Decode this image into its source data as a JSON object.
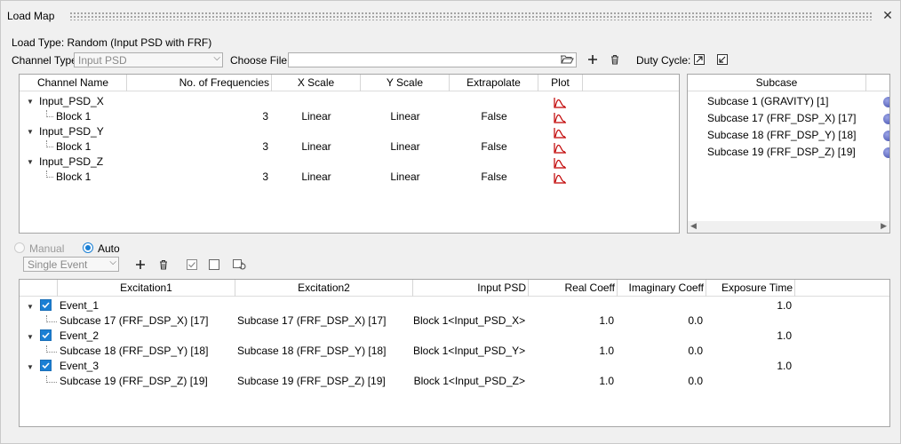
{
  "window": {
    "title": "Load Map",
    "close_glyph": "✕"
  },
  "load_type": "Load Type: Random (Input PSD with FRF)",
  "channel_type": {
    "label": "Channel Type:",
    "value": "Input PSD"
  },
  "choose_file": {
    "label": "Choose File:",
    "value": ""
  },
  "duty_cycle": {
    "label": "Duty Cycle:"
  },
  "channel_table": {
    "headers": [
      "Channel Name",
      "No. of Frequencies",
      "X Scale",
      "Y Scale",
      "Extrapolate",
      "Plot"
    ],
    "rows": [
      {
        "name": "Input_PSD_X",
        "block": "Block 1",
        "freqs": "3",
        "xscale": "Linear",
        "yscale": "Linear",
        "extrap": "False"
      },
      {
        "name": "Input_PSD_Y",
        "block": "Block 1",
        "freqs": "3",
        "xscale": "Linear",
        "yscale": "Linear",
        "extrap": "False"
      },
      {
        "name": "Input_PSD_Z",
        "block": "Block 1",
        "freqs": "3",
        "xscale": "Linear",
        "yscale": "Linear",
        "extrap": "False"
      }
    ]
  },
  "subcase_panel": {
    "header": "Subcase",
    "items": [
      "Subcase 1 (GRAVITY) [1]",
      "Subcase 17 (FRF_DSP_X) [17]",
      "Subcase 18 (FRF_DSP_Y) [18]",
      "Subcase 19 (FRF_DSP_Z) [19]"
    ]
  },
  "mode": {
    "manual": "Manual",
    "auto": "Auto",
    "selected": "Auto"
  },
  "event_type": {
    "value": "Single Event"
  },
  "event_table": {
    "headers": [
      "Excitation1",
      "Excitation2",
      "Input PSD",
      "Real Coeff",
      "Imaginary Coeff",
      "Exposure Time"
    ],
    "rows": [
      {
        "event": "Event_1",
        "exposure": "1.0",
        "exc1": "Subcase 17 (FRF_DSP_X) [17]",
        "exc2": "Subcase 17 (FRF_DSP_X) [17]",
        "psd": "Block 1<Input_PSD_X>",
        "real": "1.0",
        "imag": "0.0"
      },
      {
        "event": "Event_2",
        "exposure": "1.0",
        "exc1": "Subcase 18 (FRF_DSP_Y) [18]",
        "exc2": "Subcase 18 (FRF_DSP_Y) [18]",
        "psd": "Block 1<Input_PSD_Y>",
        "real": "1.0",
        "imag": "0.0"
      },
      {
        "event": "Event_3",
        "exposure": "1.0",
        "exc1": "Subcase 19 (FRF_DSP_Z) [19]",
        "exc2": "Subcase 19 (FRF_DSP_Z) [19]",
        "psd": "Block 1<Input_PSD_Z>",
        "real": "1.0",
        "imag": "0.0"
      }
    ]
  },
  "colors": {
    "accent": "#1a7fd4",
    "plot_icon": "#c00000"
  }
}
